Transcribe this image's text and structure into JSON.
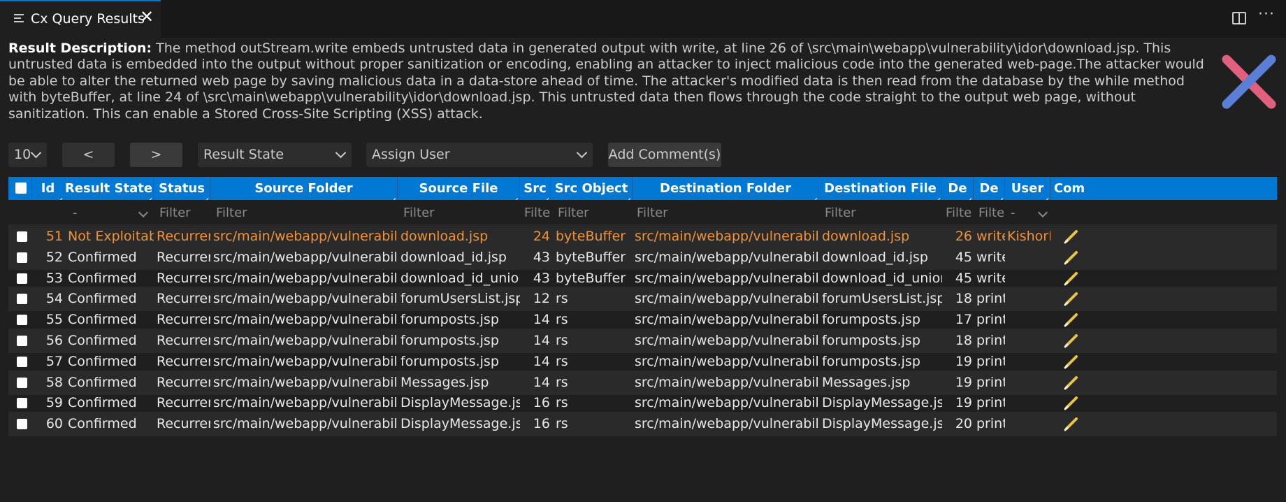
{
  "tab": {
    "title": "Cx Query Results",
    "close": "✕"
  },
  "header_icons": {
    "split": "split-editor-icon",
    "more": "···"
  },
  "description": {
    "label": "Result Description:",
    "text": " The method outStream.write embeds untrusted data in generated output with write, at line 26 of \\src\\main\\webapp\\vulnerability\\idor\\download.jsp. This untrusted data is embedded into the output without proper sanitization or encoding, enabling an attacker to inject malicious code into the generated web-page.The attacker would be able to alter the returned web page by saving malicious data in a data-store ahead of time. The attacker's modified data is then read from the database by the while method with byteBuffer, at line 24 of \\src\\main\\webapp\\vulnerability\\idor\\download.jsp. This untrusted data then flows through the code straight to the output web page, without sanitization. This can enable a Stored Cross-Site Scripting (XSS) attack."
  },
  "toolbar": {
    "page_size": "10",
    "prev": "<",
    "next": ">",
    "result_state": "Result State",
    "assign_user": "Assign User",
    "add_comment": "Add Comment(s)"
  },
  "columns": {
    "id": "Id",
    "result_state": "Result State",
    "status": "Status",
    "source_folder": "Source Folder",
    "source_file": "Source File",
    "src_line": "Src",
    "src_object": "Src Object",
    "dest_folder": "Destination Folder",
    "dest_file": "Destination File",
    "dest_line": "De",
    "dest_object": "De",
    "user": "User",
    "comment": "Com"
  },
  "filters": {
    "result_state": "-",
    "status": "Filter",
    "source_folder": "Filter",
    "source_file": "Filter",
    "src_line": "Filte",
    "src_object": "Filter",
    "dest_folder": "Filter",
    "dest_file": "Filter",
    "dest_line": "Filte",
    "dest_object": "Filte",
    "user": "-"
  },
  "rows": [
    {
      "id": "51",
      "state": "Not Exploitable",
      "status": "Recurrent",
      "src_folder": "src/main/webapp/vulnerability/idor",
      "src_file": "download.jsp",
      "src_line": "24",
      "src_obj": "byteBuffer",
      "dst_folder": "src/main/webapp/vulnerability/idor",
      "dst_file": "download.jsp",
      "dst_line": "26",
      "dst_obj": "write",
      "user": "KishorH"
    },
    {
      "id": "52",
      "state": "Confirmed",
      "status": "Recurrent",
      "src_folder": "src/main/webapp/vulnerability/sqli",
      "src_file": "download_id.jsp",
      "src_line": "43",
      "src_obj": "byteBuffer",
      "dst_folder": "src/main/webapp/vulnerability/sqli",
      "dst_file": "download_id.jsp",
      "dst_line": "45",
      "dst_obj": "write",
      "user": ""
    },
    {
      "id": "53",
      "state": "Confirmed",
      "status": "Recurrent",
      "src_folder": "src/main/webapp/vulnerability/sqli",
      "src_file": "download_id_union.jsp",
      "src_line": "43",
      "src_obj": "byteBuffer",
      "dst_folder": "src/main/webapp/vulnerability/sqli",
      "dst_file": "download_id_union.jsp",
      "dst_line": "45",
      "dst_obj": "write",
      "user": ""
    },
    {
      "id": "54",
      "state": "Confirmed",
      "status": "Recurrent",
      "src_folder": "src/main/webapp/vulnerability",
      "src_file": "forumUsersList.jsp",
      "src_line": "12",
      "src_obj": "rs",
      "dst_folder": "src/main/webapp/vulnerability",
      "dst_file": "forumUsersList.jsp",
      "dst_line": "18",
      "dst_obj": "print",
      "user": ""
    },
    {
      "id": "55",
      "state": "Confirmed",
      "status": "Recurrent",
      "src_folder": "src/main/webapp/vulnerability",
      "src_file": "forumposts.jsp",
      "src_line": "14",
      "src_obj": "rs",
      "dst_folder": "src/main/webapp/vulnerability",
      "dst_file": "forumposts.jsp",
      "dst_line": "17",
      "dst_obj": "print",
      "user": ""
    },
    {
      "id": "56",
      "state": "Confirmed",
      "status": "Recurrent",
      "src_folder": "src/main/webapp/vulnerability",
      "src_file": "forumposts.jsp",
      "src_line": "14",
      "src_obj": "rs",
      "dst_folder": "src/main/webapp/vulnerability",
      "dst_file": "forumposts.jsp",
      "dst_line": "18",
      "dst_obj": "print",
      "user": ""
    },
    {
      "id": "57",
      "state": "Confirmed",
      "status": "Recurrent",
      "src_folder": "src/main/webapp/vulnerability",
      "src_file": "forumposts.jsp",
      "src_line": "14",
      "src_obj": "rs",
      "dst_folder": "src/main/webapp/vulnerability",
      "dst_file": "forumposts.jsp",
      "dst_line": "19",
      "dst_obj": "print",
      "user": ""
    },
    {
      "id": "58",
      "state": "Confirmed",
      "status": "Recurrent",
      "src_folder": "src/main/webapp/vulnerability",
      "src_file": "Messages.jsp",
      "src_line": "14",
      "src_obj": "rs",
      "dst_folder": "src/main/webapp/vulnerability",
      "dst_file": "Messages.jsp",
      "dst_line": "19",
      "dst_obj": "print",
      "user": ""
    },
    {
      "id": "59",
      "state": "Confirmed",
      "status": "Recurrent",
      "src_folder": "src/main/webapp/vulnerability",
      "src_file": "DisplayMessage.jsp",
      "src_line": "16",
      "src_obj": "rs",
      "dst_folder": "src/main/webapp/vulnerability",
      "dst_file": "DisplayMessage.jsp",
      "dst_line": "19",
      "dst_obj": "print",
      "user": ""
    },
    {
      "id": "60",
      "state": "Confirmed",
      "status": "Recurrent",
      "src_folder": "src/main/webapp/vulnerability",
      "src_file": "DisplayMessage.jsp",
      "src_line": "16",
      "src_obj": "rs",
      "dst_folder": "src/main/webapp/vulnerability",
      "dst_file": "DisplayMessage.jsp",
      "dst_line": "20",
      "dst_obj": "print",
      "user": ""
    }
  ],
  "colors": {
    "accent": "#0078d4",
    "selected_text": "#f0933a",
    "pencil": "#e8c547",
    "cross_pink": "#e0607e",
    "cross_blue": "#5b7fd6"
  }
}
